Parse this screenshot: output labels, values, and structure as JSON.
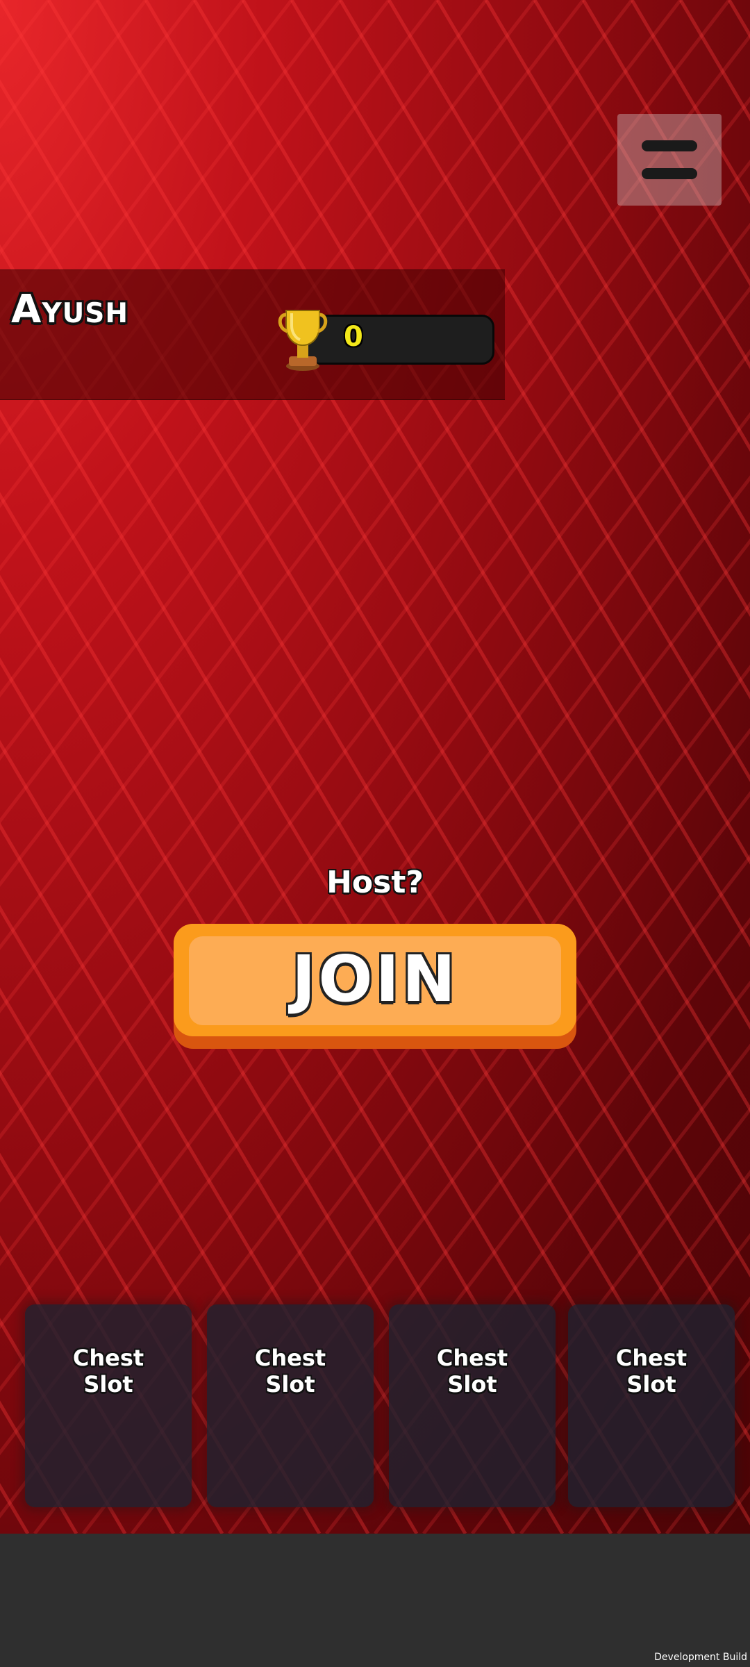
{
  "player": {
    "name": "Ayush",
    "trophies": "0"
  },
  "lobby": {
    "host_label": "Host?",
    "join_label": "JOIN"
  },
  "chest_slots": [
    {
      "label": "Chest\nSlot"
    },
    {
      "label": "Chest\nSlot"
    },
    {
      "label": "Chest\nSlot"
    },
    {
      "label": "Chest\nSlot"
    }
  ],
  "footer": {
    "build_label": "Development Build"
  },
  "colors": {
    "background_red": "#c0121a",
    "join_button": "#fdac54",
    "trophy_text": "#f3e81a",
    "chest_slot": "#1e2230"
  },
  "icons": {
    "menu": "hamburger-menu-icon",
    "trophy": "trophy-icon"
  }
}
